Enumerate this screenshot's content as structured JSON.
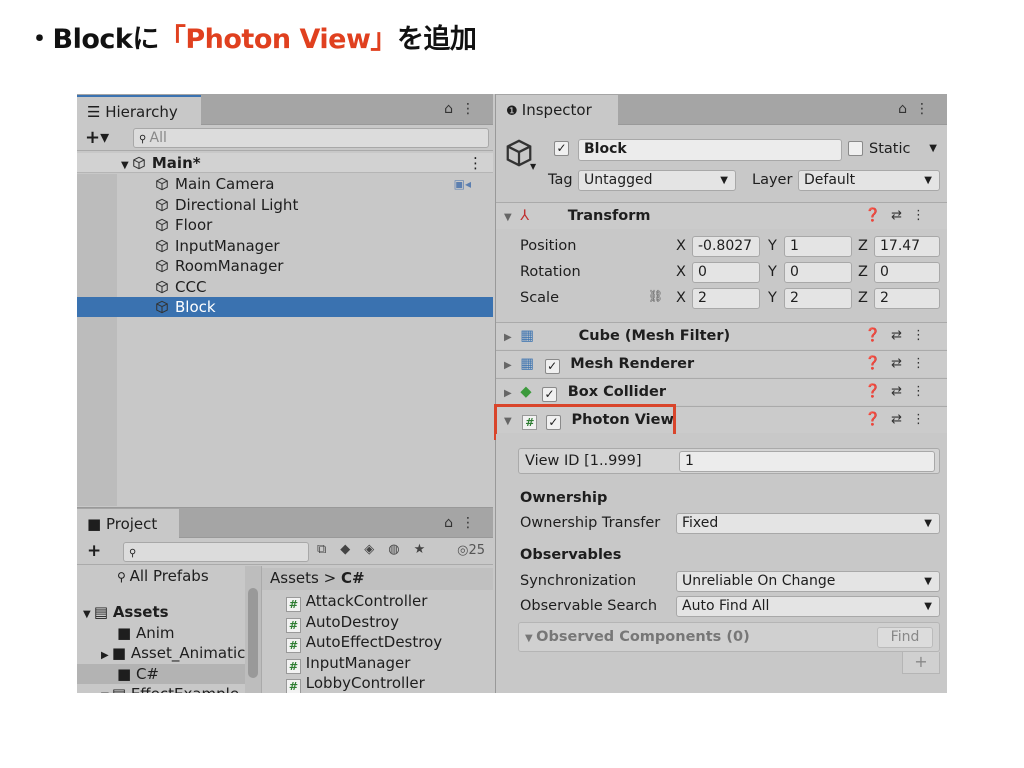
{
  "slide": {
    "bullet": "・",
    "title_prefix": "Blockに",
    "title_highlight": "「Photon View」",
    "title_suffix": "を追加"
  },
  "hierarchy": {
    "tab": "Hierarchy",
    "search_placeholder": "All",
    "scene": "Main*",
    "items": [
      "Main Camera",
      "Directional Light",
      "Floor",
      "InputManager",
      "RoomManager",
      "CCC",
      "Block"
    ],
    "selected_index": 6
  },
  "project": {
    "tab": "Project",
    "count": "25",
    "all_prefabs": "All Prefabs",
    "tree": [
      "Assets",
      "Anim",
      "Asset_Animatic",
      "C#",
      "EffectExample"
    ],
    "breadcrumb_root": "Assets",
    "breadcrumb_sep": ">",
    "breadcrumb_current": "C#",
    "scripts": [
      "AttackController",
      "AutoDestroy",
      "AutoEffectDestroy",
      "InputManager",
      "LobbyController"
    ]
  },
  "inspector": {
    "tab": "Inspector",
    "object_name": "Block",
    "static_label": "Static",
    "tag_label": "Tag",
    "tag_value": "Untagged",
    "layer_label": "Layer",
    "layer_value": "Default",
    "transform": {
      "title": "Transform",
      "position_label": "Position",
      "rotation_label": "Rotation",
      "scale_label": "Scale",
      "x": "X",
      "y": "Y",
      "z": "Z",
      "position": [
        "-0.8027",
        "1",
        "17.47"
      ],
      "rotation": [
        "0",
        "0",
        "0"
      ],
      "scale": [
        "2",
        "2",
        "2"
      ]
    },
    "components": [
      "Cube (Mesh Filter)",
      "Mesh Renderer",
      "Box Collider",
      "Photon View"
    ],
    "photon": {
      "viewid_label": "View ID [1..999]",
      "viewid_value": "1",
      "ownership_header": "Ownership",
      "ownership_transfer_label": "Ownership Transfer",
      "ownership_transfer_value": "Fixed",
      "observables_header": "Observables",
      "sync_label": "Synchronization",
      "sync_value": "Unreliable On Change",
      "search_label": "Observable Search",
      "search_value": "Auto Find All",
      "observed_label": "Observed Components (0)",
      "find_label": "Find",
      "add_label": "+"
    }
  },
  "colors": {
    "highlight": "#e0401f",
    "selection": "#3a72b0"
  }
}
